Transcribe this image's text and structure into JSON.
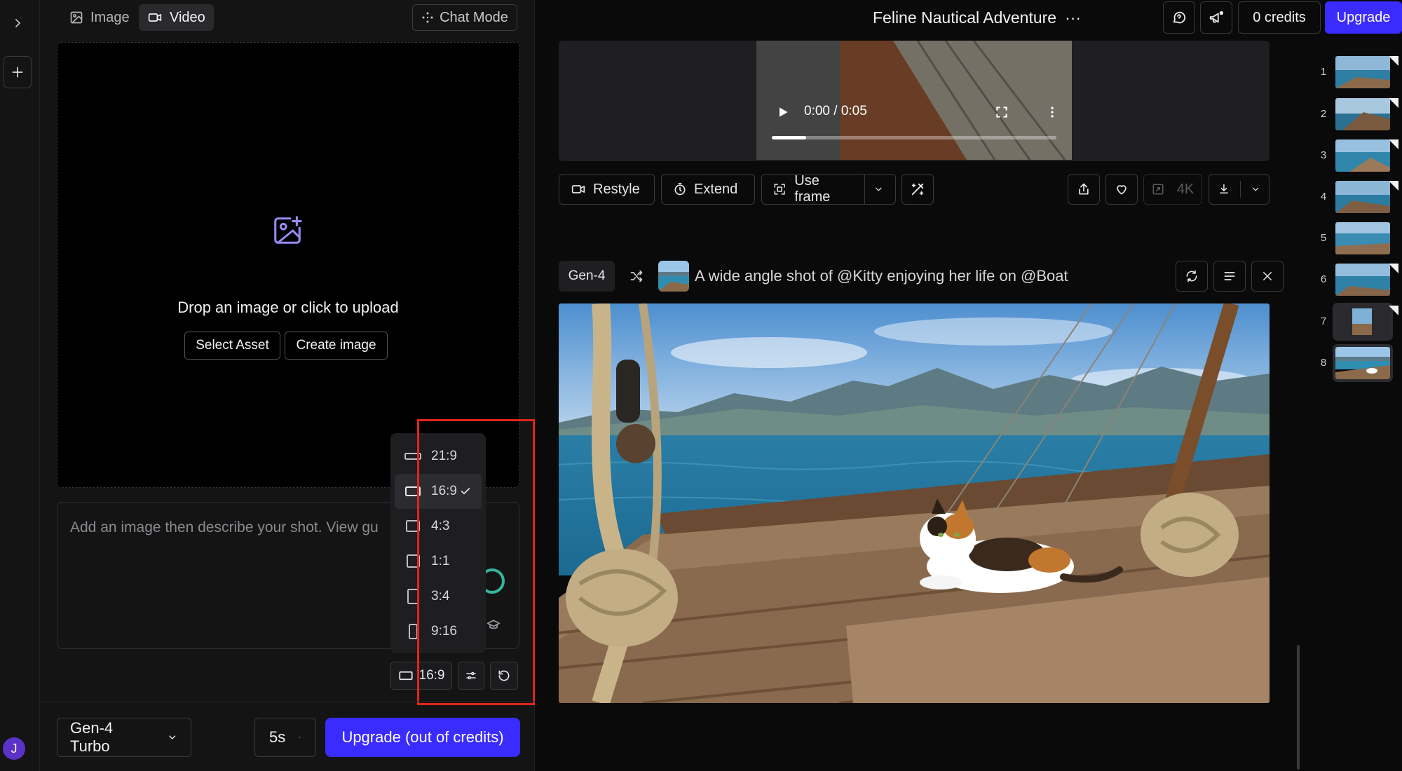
{
  "left_panel": {
    "tabs": [
      {
        "label": "Image",
        "icon": "image-icon",
        "active": false
      },
      {
        "label": "Video",
        "icon": "video-icon",
        "active": true
      }
    ],
    "chat_mode_label": "Chat Mode",
    "dropzone": {
      "text": "Drop an image or click to upload",
      "select_asset_label": "Select Asset",
      "create_image_label": "Create image"
    },
    "prompt": {
      "placeholder": "Add an image then describe your shot. View gu"
    },
    "aspect_ratio": {
      "current": "16:9",
      "options": [
        {
          "label": "21:9",
          "selected": false
        },
        {
          "label": "16:9",
          "selected": true
        },
        {
          "label": "4:3",
          "selected": false
        },
        {
          "label": "1:1",
          "selected": false
        },
        {
          "label": "3:4",
          "selected": false
        },
        {
          "label": "9:16",
          "selected": false
        }
      ]
    },
    "model_label": "Gen-4 Turbo",
    "duration_label": "5s",
    "generate_label": "Upgrade (out of credits)",
    "user_initial": "J"
  },
  "header": {
    "project_title": "Feline Nautical Adventure",
    "more_label": "···",
    "credits_label": "0 credits",
    "upgrade_label": "Upgrade"
  },
  "video_player": {
    "time": "0:00 / 0:05",
    "progress": 0.12
  },
  "actions": {
    "restyle": "Restyle",
    "extend": "Extend",
    "use_frame": "Use frame",
    "upscale": "4K"
  },
  "generation": {
    "model_badge": "Gen-4",
    "prompt": "A wide angle shot of @Kitty enjoying her life on @Boat"
  },
  "thumbnails": [
    {
      "number": "1",
      "selected": false
    },
    {
      "number": "2",
      "selected": false
    },
    {
      "number": "3",
      "selected": false
    },
    {
      "number": "4",
      "selected": false
    },
    {
      "number": "5",
      "selected": false
    },
    {
      "number": "6",
      "selected": false
    },
    {
      "number": "7",
      "selected": true
    },
    {
      "number": "8",
      "selected": true
    }
  ],
  "colors": {
    "accent": "#3a2bff",
    "highlight": "#e1251b",
    "icon_accent": "#9a88f0",
    "avatar": "#5a32c8"
  }
}
